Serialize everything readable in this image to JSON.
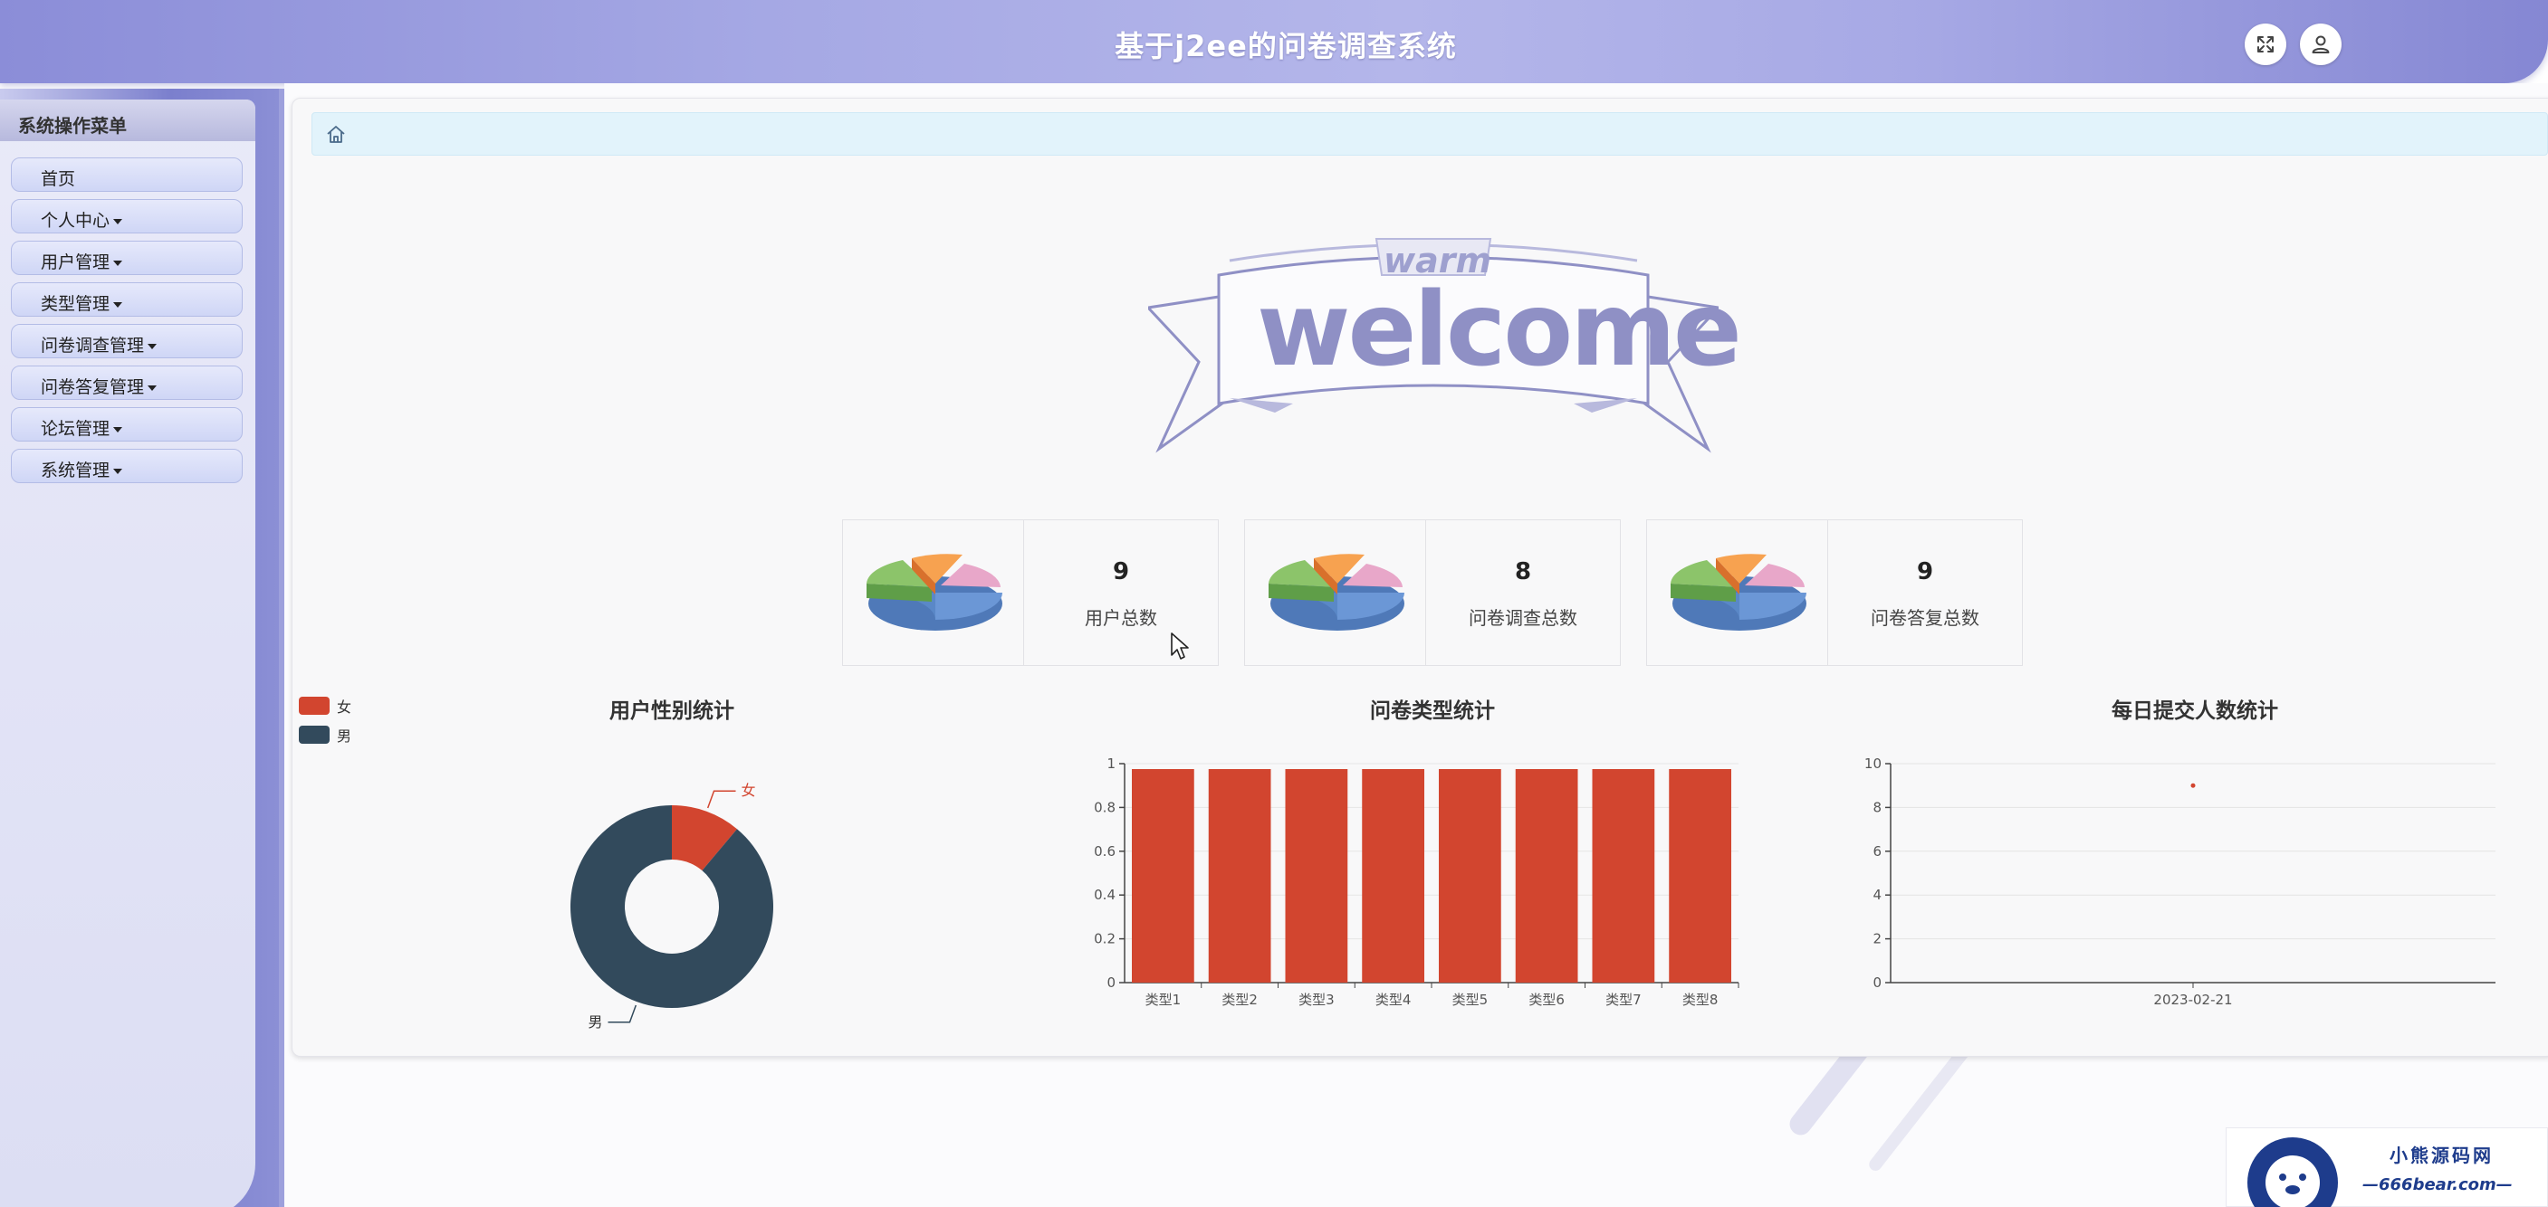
{
  "header": {
    "title": "基于j2ee的问卷调查系统"
  },
  "sidebar": {
    "title": "系统操作菜单",
    "items": [
      {
        "label": "首页",
        "has_caret": false
      },
      {
        "label": "个人中心",
        "has_caret": true
      },
      {
        "label": "用户管理",
        "has_caret": true
      },
      {
        "label": "类型管理",
        "has_caret": true
      },
      {
        "label": "问卷调查管理",
        "has_caret": true
      },
      {
        "label": "问卷答复管理",
        "has_caret": true
      },
      {
        "label": "论坛管理",
        "has_caret": true
      },
      {
        "label": "系统管理",
        "has_caret": true
      }
    ]
  },
  "welcome": {
    "top_word": "warm",
    "main_word": "welcome"
  },
  "stats": [
    {
      "value": "9",
      "label": "用户总数"
    },
    {
      "value": "8",
      "label": "问卷调查总数"
    },
    {
      "value": "9",
      "label": "问卷答复总数"
    }
  ],
  "colors": {
    "accent_red": "#d2452f",
    "dark_slate": "#324a5c",
    "header_purple": "#a5a8e4"
  },
  "watermark": {
    "top": "小熊源码网",
    "bottom": "—666bear.com—"
  },
  "chart_data": [
    {
      "type": "pie",
      "title": "用户性别统计",
      "legend": [
        "女",
        "男"
      ],
      "legend_position": "top-left",
      "values": [
        {
          "name": "女",
          "value": 1,
          "color": "#d2452f"
        },
        {
          "name": "男",
          "value": 8,
          "color": "#324a5c"
        }
      ]
    },
    {
      "type": "bar",
      "title": "问卷类型统计",
      "categories": [
        "类型1",
        "类型2",
        "类型3",
        "类型4",
        "类型5",
        "类型6",
        "类型7",
        "类型8"
      ],
      "values": [
        1,
        1,
        1,
        1,
        1,
        1,
        1,
        1
      ],
      "ylim": [
        0,
        1
      ],
      "yticks": [
        "0",
        "0.2",
        "0.4",
        "0.6",
        "0.8",
        "1"
      ],
      "color": "#d2452f"
    },
    {
      "type": "line",
      "title": "每日提交人数统计",
      "x": [
        "2023-02-21"
      ],
      "values": [
        9
      ],
      "ylim": [
        0,
        10
      ],
      "yticks": [
        "0",
        "2",
        "4",
        "6",
        "8",
        "10"
      ],
      "color": "#d2452f"
    }
  ]
}
